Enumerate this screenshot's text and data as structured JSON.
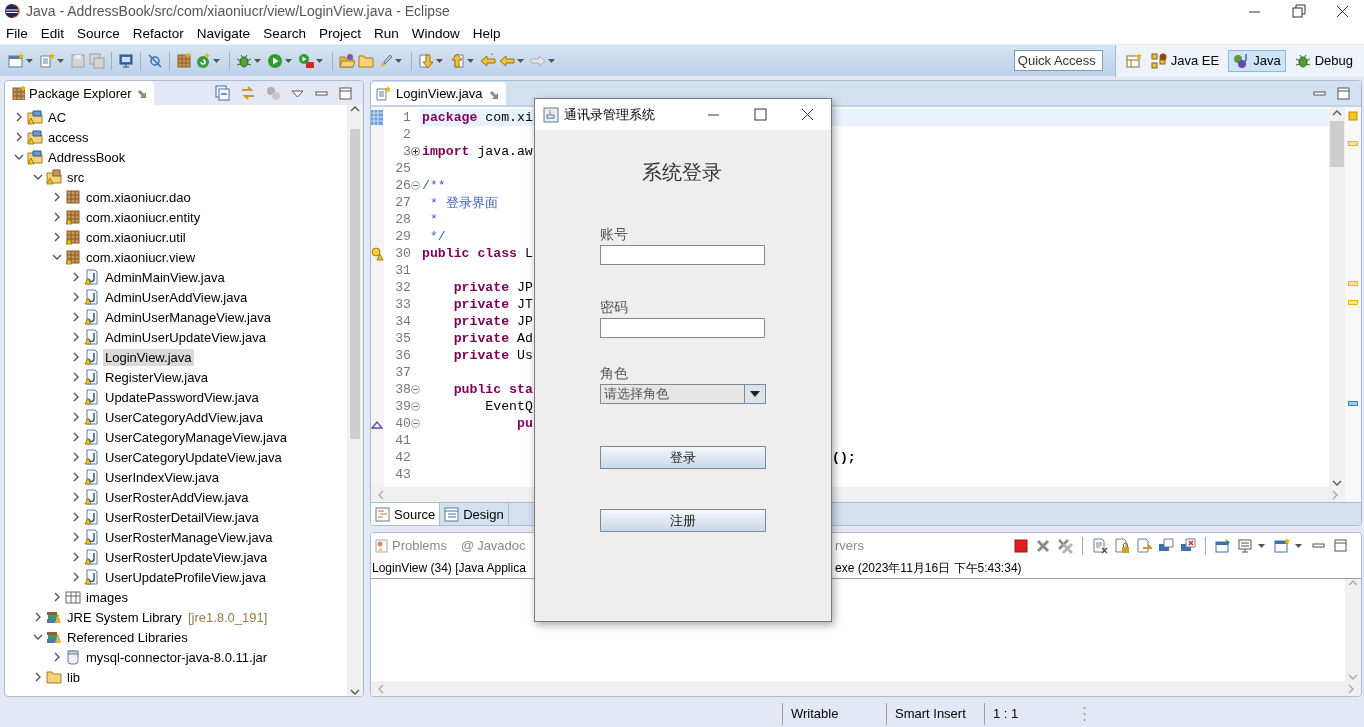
{
  "window": {
    "title": "Java - AddressBook/src/com/xiaoniucr/view/LoginView.java - Eclipse"
  },
  "menu": [
    "File",
    "Edit",
    "Source",
    "Refactor",
    "Navigate",
    "Search",
    "Project",
    "Run",
    "Window",
    "Help"
  ],
  "quick_access": {
    "placeholder": "Quick Access"
  },
  "perspectives": [
    {
      "label": "Java EE",
      "kind": "javaee",
      "selected": false
    },
    {
      "label": "Java",
      "kind": "java",
      "selected": true
    },
    {
      "label": "Debug",
      "kind": "debug",
      "selected": false
    }
  ],
  "package_explorer": {
    "title": "Package Explorer",
    "tree": [
      {
        "label": "AC",
        "kind": "project",
        "warning": true,
        "expanded": false,
        "selected": false
      },
      {
        "label": "access",
        "kind": "project",
        "warning": true,
        "expanded": false,
        "selected": false
      },
      {
        "label": "AddressBook",
        "kind": "project",
        "warning": true,
        "expanded": true,
        "selected": false,
        "children": [
          {
            "label": "src",
            "kind": "source-folder",
            "warning": true,
            "expanded": true,
            "selected": false,
            "children": [
              {
                "label": "com.xiaoniucr.dao",
                "kind": "package",
                "warning": false,
                "expanded": false,
                "selected": false
              },
              {
                "label": "com.xiaoniucr.entity",
                "kind": "package",
                "warning": true,
                "expanded": false,
                "selected": false
              },
              {
                "label": "com.xiaoniucr.util",
                "kind": "package",
                "warning": true,
                "expanded": false,
                "selected": false
              },
              {
                "label": "com.xiaoniucr.view",
                "kind": "package",
                "warning": true,
                "expanded": true,
                "selected": false,
                "children": [
                  {
                    "label": "AdminMainView.java",
                    "kind": "java-file",
                    "warning": true,
                    "expanded": false,
                    "selected": false
                  },
                  {
                    "label": "AdminUserAddView.java",
                    "kind": "java-file",
                    "warning": true,
                    "expanded": false,
                    "selected": false
                  },
                  {
                    "label": "AdminUserManageView.java",
                    "kind": "java-file",
                    "warning": true,
                    "expanded": false,
                    "selected": false
                  },
                  {
                    "label": "AdminUserUpdateView.java",
                    "kind": "java-file",
                    "warning": true,
                    "expanded": false,
                    "selected": false
                  },
                  {
                    "label": "LoginView.java",
                    "kind": "java-file",
                    "warning": true,
                    "expanded": false,
                    "selected": true
                  },
                  {
                    "label": "RegisterView.java",
                    "kind": "java-file",
                    "warning": true,
                    "expanded": false,
                    "selected": false
                  },
                  {
                    "label": "UpdatePasswordView.java",
                    "kind": "java-file",
                    "warning": true,
                    "expanded": false,
                    "selected": false
                  },
                  {
                    "label": "UserCategoryAddView.java",
                    "kind": "java-file",
                    "warning": true,
                    "expanded": false,
                    "selected": false
                  },
                  {
                    "label": "UserCategoryManageView.java",
                    "kind": "java-file",
                    "warning": true,
                    "expanded": false,
                    "selected": false
                  },
                  {
                    "label": "UserCategoryUpdateView.java",
                    "kind": "java-file",
                    "warning": true,
                    "expanded": false,
                    "selected": false
                  },
                  {
                    "label": "UserIndexView.java",
                    "kind": "java-file",
                    "warning": true,
                    "expanded": false,
                    "selected": false
                  },
                  {
                    "label": "UserRosterAddView.java",
                    "kind": "java-file",
                    "warning": true,
                    "expanded": false,
                    "selected": false
                  },
                  {
                    "label": "UserRosterDetailView.java",
                    "kind": "java-file",
                    "warning": true,
                    "expanded": false,
                    "selected": false
                  },
                  {
                    "label": "UserRosterManageView.java",
                    "kind": "java-file",
                    "warning": true,
                    "expanded": false,
                    "selected": false
                  },
                  {
                    "label": "UserRosterUpdateView.java",
                    "kind": "java-file",
                    "warning": true,
                    "expanded": false,
                    "selected": false
                  },
                  {
                    "label": "UserUpdateProfileView.java",
                    "kind": "java-file",
                    "warning": true,
                    "expanded": false,
                    "selected": false
                  }
                ]
              },
              {
                "label": "images",
                "kind": "image-folder",
                "warning": false,
                "expanded": false,
                "selected": false
              }
            ]
          },
          {
            "label": "JRE System Library",
            "decoration": "[jre1.8.0_191]",
            "kind": "library",
            "warning": false,
            "expanded": false,
            "selected": false
          },
          {
            "label": "Referenced Libraries",
            "kind": "library",
            "warning": false,
            "expanded": true,
            "selected": false,
            "children": [
              {
                "label": "mysql-connector-java-8.0.11.jar",
                "kind": "jar",
                "warning": false,
                "expanded": false,
                "selected": false
              }
            ]
          },
          {
            "label": "lib",
            "kind": "folder",
            "warning": false,
            "expanded": false,
            "selected": false
          }
        ]
      }
    ]
  },
  "editor": {
    "tabs": [
      {
        "label": "LoginView.java",
        "selected": true
      }
    ],
    "lines": [
      {
        "number": "1",
        "kind": "top",
        "current": true,
        "changed": true,
        "parts": [
          {
            "kind": "keyword",
            "text": "package"
          },
          {
            "kind": "plain",
            "text": "com.xi"
          }
        ]
      },
      {
        "number": "2",
        "kind": "top",
        "current": false
      },
      {
        "number": "3",
        "kind": "top",
        "current": false,
        "folded": true,
        "parts": [
          {
            "kind": "keyword",
            "text": "import"
          },
          {
            "kind": "plain",
            "text": "java.aw"
          }
        ]
      },
      {
        "number": "25",
        "kind": "top",
        "current": false
      },
      {
        "number": "26",
        "kind": "top",
        "current": false,
        "folded": false,
        "parts": [
          {
            "kind": "doc",
            "text": "/**"
          }
        ]
      },
      {
        "number": "27",
        "kind": "doc-body",
        "current": false,
        "parts": [
          {
            "kind": "doc",
            "text": "* 登录界面"
          }
        ]
      },
      {
        "number": "28",
        "kind": "doc-body",
        "current": false,
        "parts": [
          {
            "kind": "doc",
            "text": "*"
          }
        ]
      },
      {
        "number": "29",
        "kind": "doc-body",
        "current": false,
        "parts": [
          {
            "kind": "doc",
            "text": "*/"
          }
        ]
      },
      {
        "number": "30",
        "kind": "top",
        "current": false,
        "warning": true,
        "parts": [
          {
            "kind": "keyword",
            "text": "public class"
          },
          {
            "kind": "plain",
            "text": "L"
          }
        ]
      },
      {
        "number": "31",
        "kind": "top",
        "current": false
      },
      {
        "number": "32",
        "kind": "member",
        "current": false,
        "parts": [
          {
            "kind": "keyword",
            "text": "private"
          },
          {
            "kind": "plain",
            "text": "JP"
          }
        ]
      },
      {
        "number": "33",
        "kind": "member",
        "current": false,
        "parts": [
          {
            "kind": "keyword",
            "text": "private"
          },
          {
            "kind": "plain",
            "text": "JT"
          }
        ]
      },
      {
        "number": "34",
        "kind": "member",
        "current": false,
        "parts": [
          {
            "kind": "keyword",
            "text": "private"
          },
          {
            "kind": "plain",
            "text": "JP"
          }
        ]
      },
      {
        "number": "35",
        "kind": "member",
        "current": false,
        "parts": [
          {
            "kind": "keyword",
            "text": "private"
          },
          {
            "kind": "plain",
            "text": "Ad"
          }
        ]
      },
      {
        "number": "36",
        "kind": "member",
        "current": false,
        "parts": [
          {
            "kind": "keyword",
            "text": "private"
          },
          {
            "kind": "plain",
            "text": "Us"
          }
        ]
      },
      {
        "number": "37",
        "kind": "top",
        "current": false
      },
      {
        "number": "38",
        "kind": "member",
        "current": false,
        "folded": false,
        "parts": [
          {
            "kind": "keyword",
            "text": "public sta"
          }
        ]
      },
      {
        "number": "39",
        "kind": "statement",
        "current": false,
        "folded": false,
        "parts": [
          {
            "kind": "plain",
            "text": "EventQ"
          }
        ]
      },
      {
        "number": "40",
        "kind": "nested",
        "current": false,
        "folded": false,
        "overrides": true,
        "parts": [
          {
            "kind": "keyword",
            "text": "pu"
          }
        ]
      },
      {
        "number": "41",
        "kind": "top",
        "current": false
      },
      {
        "number": "42",
        "kind": "top",
        "current": false,
        "tail": "();"
      },
      {
        "number": "43",
        "kind": "top",
        "current": false
      }
    ],
    "bottom_tabs": [
      {
        "label": "Source",
        "kind": "source",
        "selected": true
      },
      {
        "label": "Design",
        "kind": "design",
        "selected": false
      }
    ]
  },
  "console": {
    "tabs": [
      {
        "label": "Problems",
        "kind": "problems"
      },
      {
        "label": "Javadoc",
        "kind": "javadoc",
        "glyph": "@"
      }
    ],
    "tabs_right": "rvers",
    "process_left": "LoginView (34) [Java Applica",
    "process_right": "exe (2023年11月16日 下午5:43:34)"
  },
  "status_bar": [
    "Writable",
    "Smart Insert",
    "1 : 1"
  ],
  "dialog": {
    "title": "通讯录管理系统",
    "heading": "系统登录",
    "fields": [
      {
        "label": "账号",
        "kind": "text"
      },
      {
        "label": "密码",
        "kind": "password"
      },
      {
        "label": "角色",
        "kind": "combo",
        "value": "请选择角色"
      }
    ],
    "buttons": [
      "登录",
      "注册"
    ]
  }
}
